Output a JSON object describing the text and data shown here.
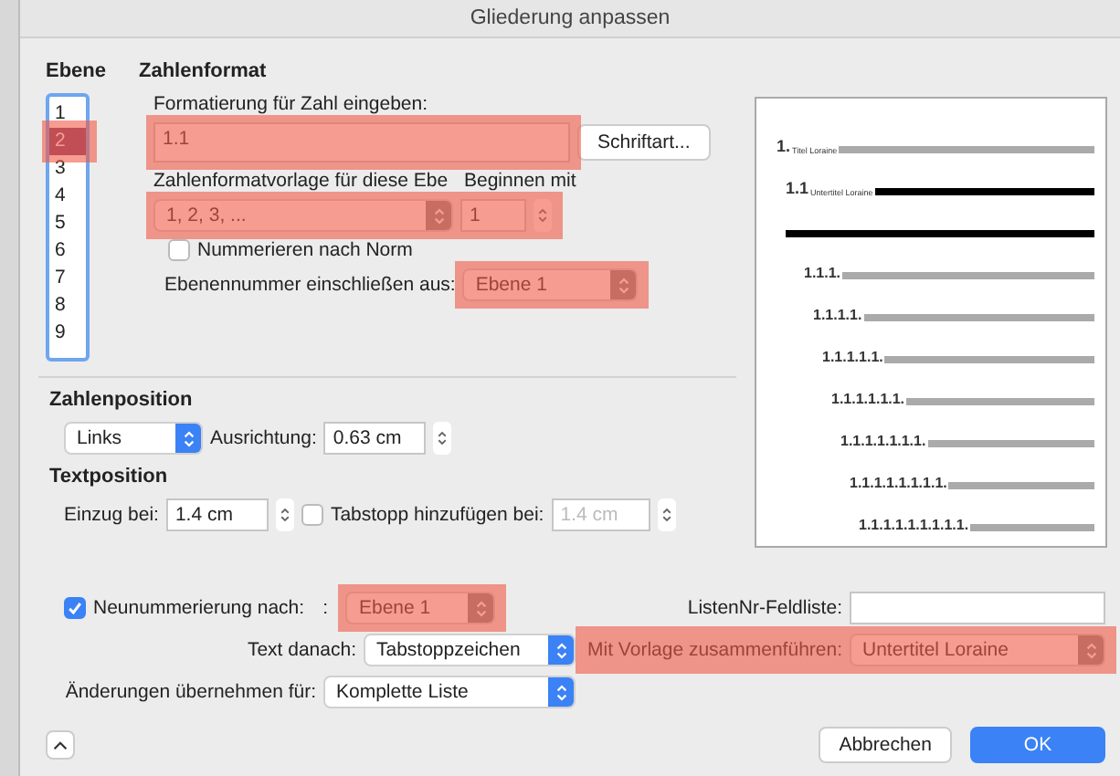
{
  "window": {
    "title": "Gliederung anpassen"
  },
  "levels": {
    "label": "Ebene",
    "items": [
      {
        "label": "1",
        "selected": false,
        "highlighted": false
      },
      {
        "label": "2",
        "selected": true,
        "highlighted": true
      },
      {
        "label": "3",
        "selected": false,
        "highlighted": false
      },
      {
        "label": "4",
        "selected": false,
        "highlighted": false
      },
      {
        "label": "5",
        "selected": false,
        "highlighted": false
      },
      {
        "label": "6",
        "selected": false,
        "highlighted": false
      },
      {
        "label": "7",
        "selected": false,
        "highlighted": false
      },
      {
        "label": "8",
        "selected": false,
        "highlighted": false
      },
      {
        "label": "9",
        "selected": false,
        "highlighted": false
      }
    ]
  },
  "number_format": {
    "heading": "Zahlenformat",
    "format_label": "Formatierung für Zahl eingeben:",
    "format_value": "1.1",
    "font_button": "Schriftart...",
    "style_label": "Zahlenformatvorlage für diese Ebe",
    "start_label": "Beginnen mit",
    "style_value": "1, 2, 3, ...",
    "start_value": "1",
    "legal_label": "Nummerieren nach Norm",
    "legal_checked": false,
    "include_label": "Ebenennummer einschließen aus:",
    "include_value": "Ebene 1",
    "format_highlighted": true,
    "style_highlighted": true,
    "include_highlighted": true
  },
  "number_position": {
    "heading": "Zahlenposition",
    "alignment_value": "Links",
    "aligned_at_label": "Ausrichtung:",
    "aligned_at_value": "0.63 cm"
  },
  "text_position": {
    "heading": "Textposition",
    "indent_label": "Einzug bei:",
    "indent_value": "1.4 cm",
    "tab_label": "Tabstopp hinzufügen bei:",
    "tab_checked": false,
    "tab_value": "1.4 cm"
  },
  "restart": {
    "label": "Neunummerierung nach:",
    "checked": true,
    "separator": ":",
    "value": "Ebene 1",
    "highlighted": true
  },
  "listnum": {
    "label": "ListenNr-Feldliste:"
  },
  "follow": {
    "label": "Text danach:",
    "value": "Tabstoppzeichen"
  },
  "link_style": {
    "label": "Mit Vorlage zusammenführen:",
    "value": "Untertitel Loraine",
    "highlighted": true
  },
  "apply": {
    "label": "Änderungen übernehmen für:",
    "value": "Komplette Liste"
  },
  "preview": [
    {
      "number": "1.",
      "caption": "Titel Loraine",
      "kind": "plain"
    },
    {
      "number": "1.1",
      "caption": "Untertitel Loraine",
      "kind": "bold"
    },
    {
      "kind": "bold"
    },
    {
      "number": "1.1.1.",
      "kind": "plain"
    },
    {
      "number": "1.1.1.1.",
      "kind": "plain"
    },
    {
      "number": "1.1.1.1.1.",
      "kind": "plain"
    },
    {
      "number": "1.1.1.1.1.1.",
      "kind": "plain"
    },
    {
      "number": "1.1.1.1.1.1.1.",
      "kind": "plain"
    },
    {
      "number": "1.1.1.1.1.1.1.1.",
      "kind": "plain"
    },
    {
      "number": "1.1.1.1.1.1.1.1.1.",
      "kind": "plain"
    }
  ],
  "buttons": [
    {
      "label": "Abbrechen",
      "kind": "secondary"
    },
    {
      "label": "OK",
      "kind": "primary"
    }
  ]
}
